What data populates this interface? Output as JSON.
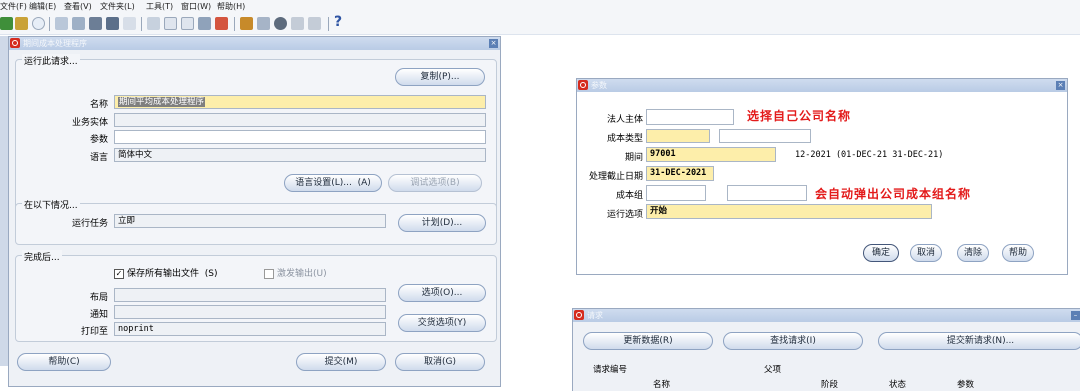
{
  "menubar": [
    "文件(F)",
    "编辑(E)",
    "查看(V)",
    "文件夹(L)",
    "工具(T)",
    "窗口(W)",
    "帮助(H)"
  ],
  "help_glyph": "?",
  "main_window": {
    "title": "期间成本处理程序",
    "close": "×",
    "run_request": {
      "group_title": "运行此请求...",
      "copy_button": "复制(P)...",
      "name_label": "名称",
      "name_value": "期间平均成本处理程序",
      "ou_label": "业务实体",
      "ou_value": "",
      "params_label": "参数",
      "params_value": "",
      "lang_label": "语言",
      "lang_value": "简体中文",
      "lang_settings_button": "语言设置(L)...",
      "lang_settings_hint": "(A)",
      "debug_button": "调试选项(B)"
    },
    "schedule": {
      "group_title": "在以下情况...",
      "run_task_label": "运行任务",
      "run_task_value": "立即",
      "schedule_button": "计划(D)..."
    },
    "completion": {
      "group_title": "完成后...",
      "save_output_label": "保存所有输出文件",
      "save_output_hint": "(S)",
      "burst_label": "激发输出(U)",
      "layout_label": "布局",
      "layout_value": "",
      "options_button": "选项(O)...",
      "notify_label": "通知",
      "notify_value": "",
      "print_to_label": "打印至",
      "print_to_value": "noprint",
      "delivery_button": "交货选项(Y)"
    },
    "help_button": "帮助(C)",
    "submit_button": "提交(M)",
    "cancel_button": "取消(G)"
  },
  "params_window": {
    "title": "参数",
    "close": "×",
    "legal_entity_label": "法人主体",
    "legal_entity_value": "",
    "cost_type_label": "成本类型",
    "cost_type_value": "",
    "period_label": "期间",
    "period_value": "97001",
    "period_desc": "12-2021 (01-DEC-21  31-DEC-21)",
    "cutoff_label": "处理截止日期",
    "cutoff_value": "31-DEC-2021",
    "cost_group_label": "成本组",
    "cost_group_value": "",
    "run_option_label": "运行选项",
    "run_option_value": "开始",
    "annotation_1": "选择自己公司名称",
    "annotation_2": "会自动弹出公司成本组名称",
    "ok_button": "确定",
    "cancel_button": "取消",
    "clear_button": "清除",
    "help_button": "帮助"
  },
  "requests_window": {
    "title": "请求",
    "refresh_button": "更新数据(R)",
    "find_button": "查找请求(I)",
    "submit_new_button": "提交新请求(N)...",
    "col_request_id": "请求编号",
    "col_parent": "父项",
    "col_name": "名称",
    "col_phase": "阶段",
    "col_status": "状态",
    "col_params": "参数"
  }
}
